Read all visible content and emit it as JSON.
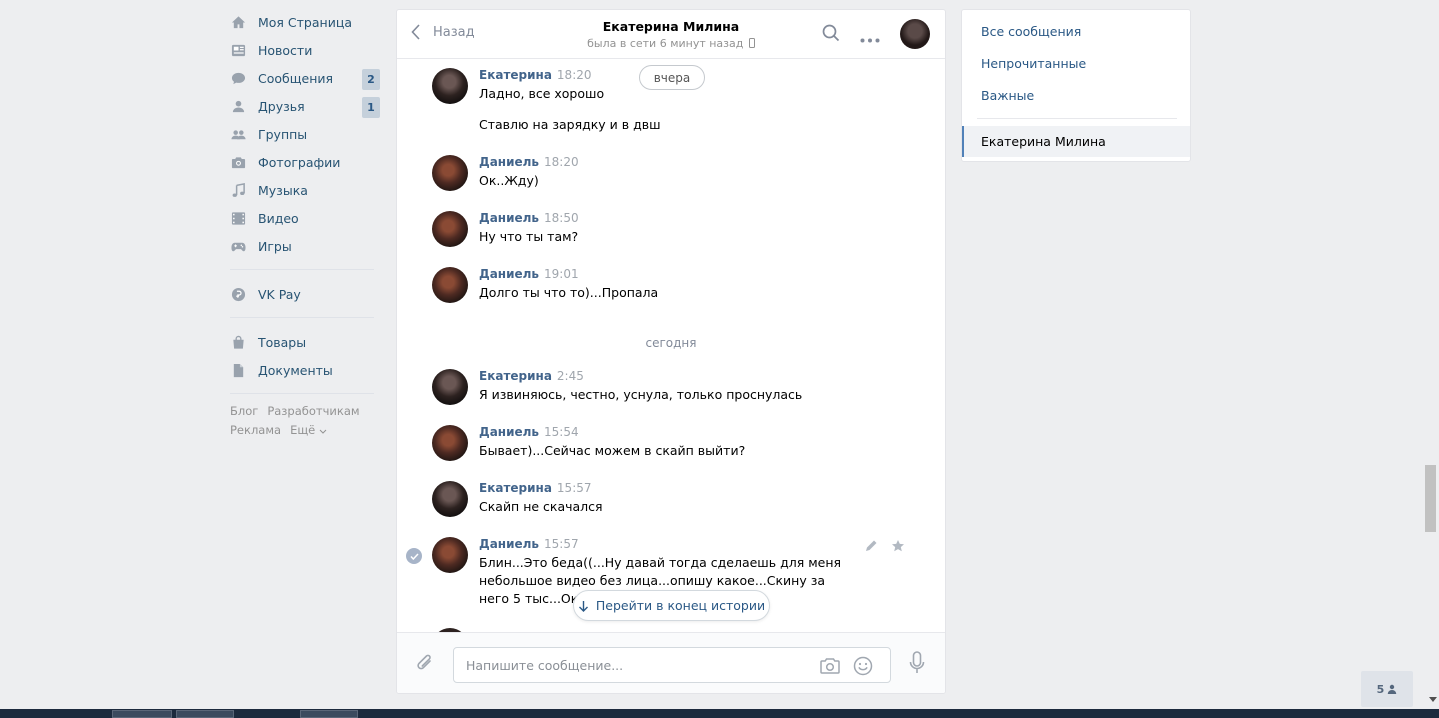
{
  "nav": {
    "items": [
      {
        "label": "Моя Страница",
        "icon": "home-icon"
      },
      {
        "label": "Новости",
        "icon": "news-icon"
      },
      {
        "label": "Сообщения",
        "icon": "messages-icon",
        "badge": "2"
      },
      {
        "label": "Друзья",
        "icon": "friends-icon",
        "badge": "1"
      },
      {
        "label": "Группы",
        "icon": "groups-icon"
      },
      {
        "label": "Фотографии",
        "icon": "camera-icon"
      },
      {
        "label": "Музыка",
        "icon": "music-icon"
      },
      {
        "label": "Видео",
        "icon": "video-icon"
      },
      {
        "label": "Игры",
        "icon": "gamepad-icon"
      }
    ],
    "vkpay": "VK Pay",
    "goods": "Товары",
    "docs": "Документы",
    "footer": {
      "blog": "Блог",
      "dev": "Разработчикам",
      "ads": "Реклама",
      "more": "Ещё"
    }
  },
  "chat": {
    "back_label": "Назад",
    "peer_name": "Екатерина Милина",
    "peer_status": "была в сети 6 минут назад",
    "input_placeholder": "Напишите сообщение...",
    "jump_label": "Перейти в конец истории",
    "day_yesterday": "вчера",
    "day_today": "сегодня",
    "messages": [
      {
        "author": "Екатерина",
        "time": "18:20",
        "text": "Ладно, все хорошо",
        "avatar": "k"
      },
      {
        "author": "",
        "time": "",
        "text": "Ставлю на зарядку и в двш",
        "avatar": ""
      },
      {
        "author": "Даниель",
        "time": "18:20",
        "text": "Ок..Жду)",
        "avatar": "d"
      },
      {
        "author": "Даниель",
        "time": "18:50",
        "text": "Ну что ты там?",
        "avatar": "d"
      },
      {
        "author": "Даниель",
        "time": "19:01",
        "text": "Долго ты что то)...Пропала",
        "avatar": "d"
      },
      {
        "author": "Екатерина",
        "time": "2:45",
        "text": "Я извиняюсь, честно, уснула, только проснулась",
        "avatar": "k"
      },
      {
        "author": "Даниель",
        "time": "15:54",
        "text": "Бывает)...Сейчас можем в скайп выйти?",
        "avatar": "d"
      },
      {
        "author": "Екатерина",
        "time": "15:57",
        "text": "Скайп не скачался",
        "avatar": "k"
      },
      {
        "author": "Даниель",
        "time": "15:57",
        "text": "Блин...Это беда((...Ну давай тогда сделаешь для меня небольшое видео без лица...опишу какое...Скину за него 5 тыс...Ок?",
        "avatar": "d"
      }
    ]
  },
  "filters": {
    "all": "Все сообщения",
    "unread": "Непрочитанные",
    "important": "Важные",
    "active_dialog": "Екатерина Милина"
  },
  "online_count": "5",
  "colors": {
    "link": "#2a5885",
    "author": "#42648b",
    "badge_bg": "#c5d0db",
    "accent": "#5181b8"
  }
}
